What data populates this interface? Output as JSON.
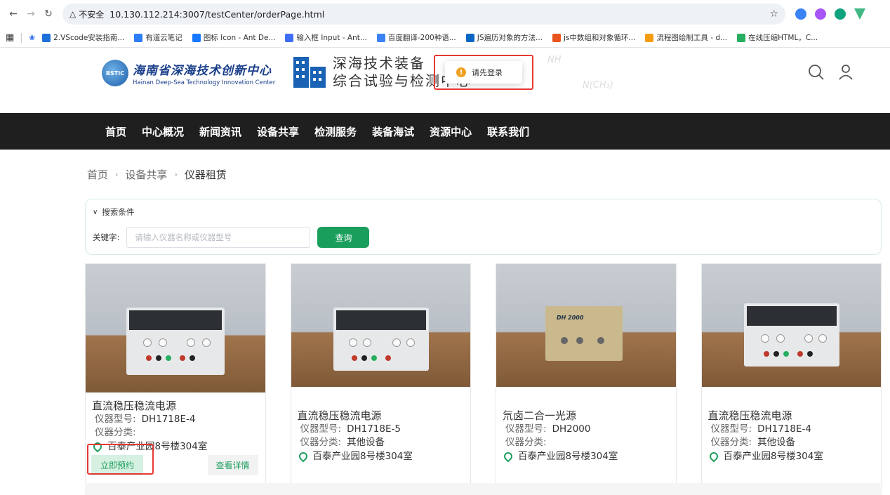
{
  "browser": {
    "insecure_label": "不安全",
    "url": "10.130.112.214:3007/testCenter/orderPage.html",
    "bookmarks": [
      {
        "label": "2.VScode安装指南...",
        "color": "#1e6fd9"
      },
      {
        "label": "有道云笔记",
        "color": "#2b7cf6"
      },
      {
        "label": "图标 Icon - Ant De...",
        "color": "#1677ff"
      },
      {
        "label": "输入框 Input - Ant...",
        "color": "#3d6ef5"
      },
      {
        "label": "百度翻译-200种语...",
        "color": "#3b82f6"
      },
      {
        "label": "JS遍历对象的方法...",
        "color": "#0a66c2"
      },
      {
        "label": "js中数组和对象循环...",
        "color": "#e8541c"
      },
      {
        "label": "流程图绘制工具 - d...",
        "color": "#f39c12"
      },
      {
        "label": "在线压缩HTML，C...",
        "color": "#27ae60"
      }
    ]
  },
  "header": {
    "logo1_badge": "BSTIC",
    "logo1_cn": "海南省深海技术创新中心",
    "logo1_en": "Hainan Deep-Sea Technology Innovation Center",
    "logo2_line1": "深海技术装备",
    "logo2_line2": "综合试验与检测中心",
    "chem1": "NH",
    "chem2": "N(CH₃)"
  },
  "toast": {
    "message": "请先登录"
  },
  "nav": [
    "首页",
    "中心概况",
    "新闻资讯",
    "设备共享",
    "检测服务",
    "装备海试",
    "资源中心",
    "联系我们"
  ],
  "breadcrumb": {
    "home": "首页",
    "parent": "设备共享",
    "current": "仪器租赁"
  },
  "search": {
    "section_title": "搜索条件",
    "keyword_label": "关键字:",
    "placeholder": "请输入仪器名称或仪器型号",
    "button": "查询"
  },
  "labels": {
    "model": "仪器型号:",
    "category": "仪器分类:"
  },
  "cards": [
    {
      "title": "直流稳压稳流电源",
      "model": "DH1718E-4",
      "category": "",
      "location": "百泰产业园8号楼304室",
      "book": "立即预约",
      "detail": "查看详情"
    },
    {
      "title": "直流稳压稳流电源",
      "model": "DH1718E-5",
      "category": "其他设备",
      "location": "百泰产业园8号楼304室"
    },
    {
      "title": "氘卤二合一光源",
      "model": "DH2000",
      "category": "",
      "location": "百泰产业园8号楼304室",
      "device_label": "DH 2000"
    },
    {
      "title": "直流稳压稳流电源",
      "model": "DH1718E-4",
      "category": "其他设备",
      "location": "百泰产业园8号楼304室"
    }
  ]
}
